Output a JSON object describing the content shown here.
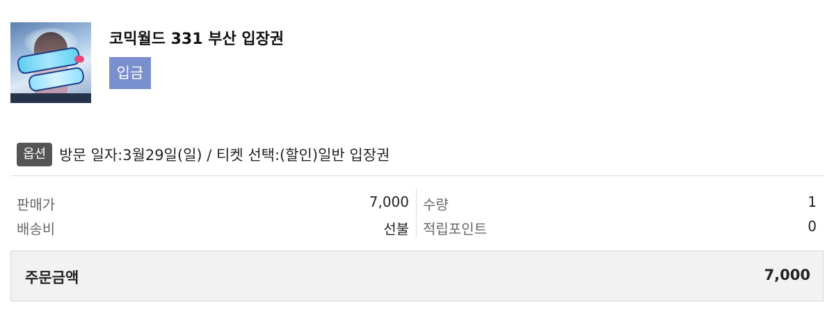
{
  "product": {
    "title": "코믹월드 331 부산 입장권",
    "status": "입금",
    "thumbnail_icon": "comic-world-poster-thumbnail"
  },
  "option": {
    "tag": "옵션",
    "text": "방문 일자:3월29일(일) / 티켓 선택:(할인)일반 입장권"
  },
  "pricing": {
    "sale_price_label": "판매가",
    "sale_price_value": "7,000",
    "quantity_label": "수량",
    "quantity_value": "1",
    "shipping_label": "배송비",
    "shipping_value": "선불",
    "points_label": "적립포인트",
    "points_value": "0"
  },
  "total": {
    "label": "주문금액",
    "value": "7,000"
  },
  "colors": {
    "status_badge": "#7a8fcf",
    "option_tag": "#555555",
    "total_bg": "#f2f2f2"
  }
}
